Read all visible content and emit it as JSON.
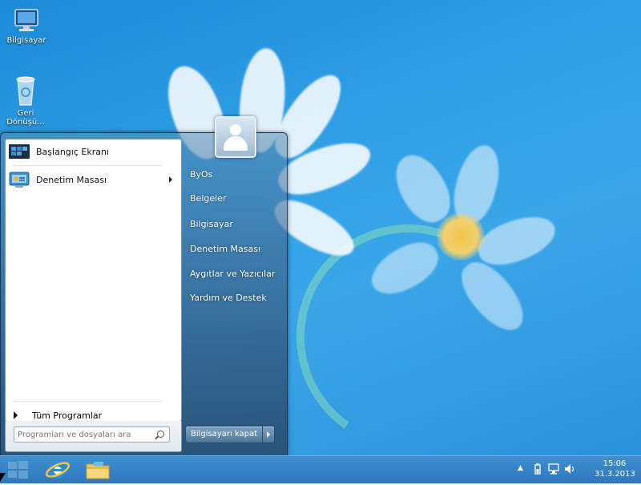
{
  "desktop": {
    "icons": [
      {
        "label": "Bilgisayar",
        "icon": "computer-icon"
      },
      {
        "label": "Geri Dönüşü...",
        "icon": "recycle-bin-icon"
      }
    ]
  },
  "start_menu": {
    "left_items": [
      {
        "label": "Başlangıç Ekranı",
        "icon": "start-screen-icon"
      },
      {
        "label": "Denetim Masası",
        "icon": "control-panel-icon",
        "has_submenu": true
      }
    ],
    "all_programs": "Tüm Programlar",
    "search": {
      "placeholder": "Programları ve dosyaları ara"
    },
    "right_items": [
      "ByOs",
      "Belgeler",
      "Bilgisayar",
      "Denetim Masası",
      "Aygıtlar ve Yazıcılar",
      "Yardım ve Destek"
    ],
    "shutdown_label": "Bilgisayarı kapat"
  },
  "taskbar": {
    "clock_time": "15:06",
    "clock_date": "31.3.2013",
    "pinned": [
      "windows-start-icon",
      "internet-explorer-icon",
      "file-explorer-icon"
    ],
    "tray_icons": [
      "show-hidden-icons-icon",
      "power-icon",
      "network-icon",
      "volume-icon"
    ]
  },
  "colors": {
    "accent": "#2d78bb",
    "desktop": "#2e9fe6"
  }
}
